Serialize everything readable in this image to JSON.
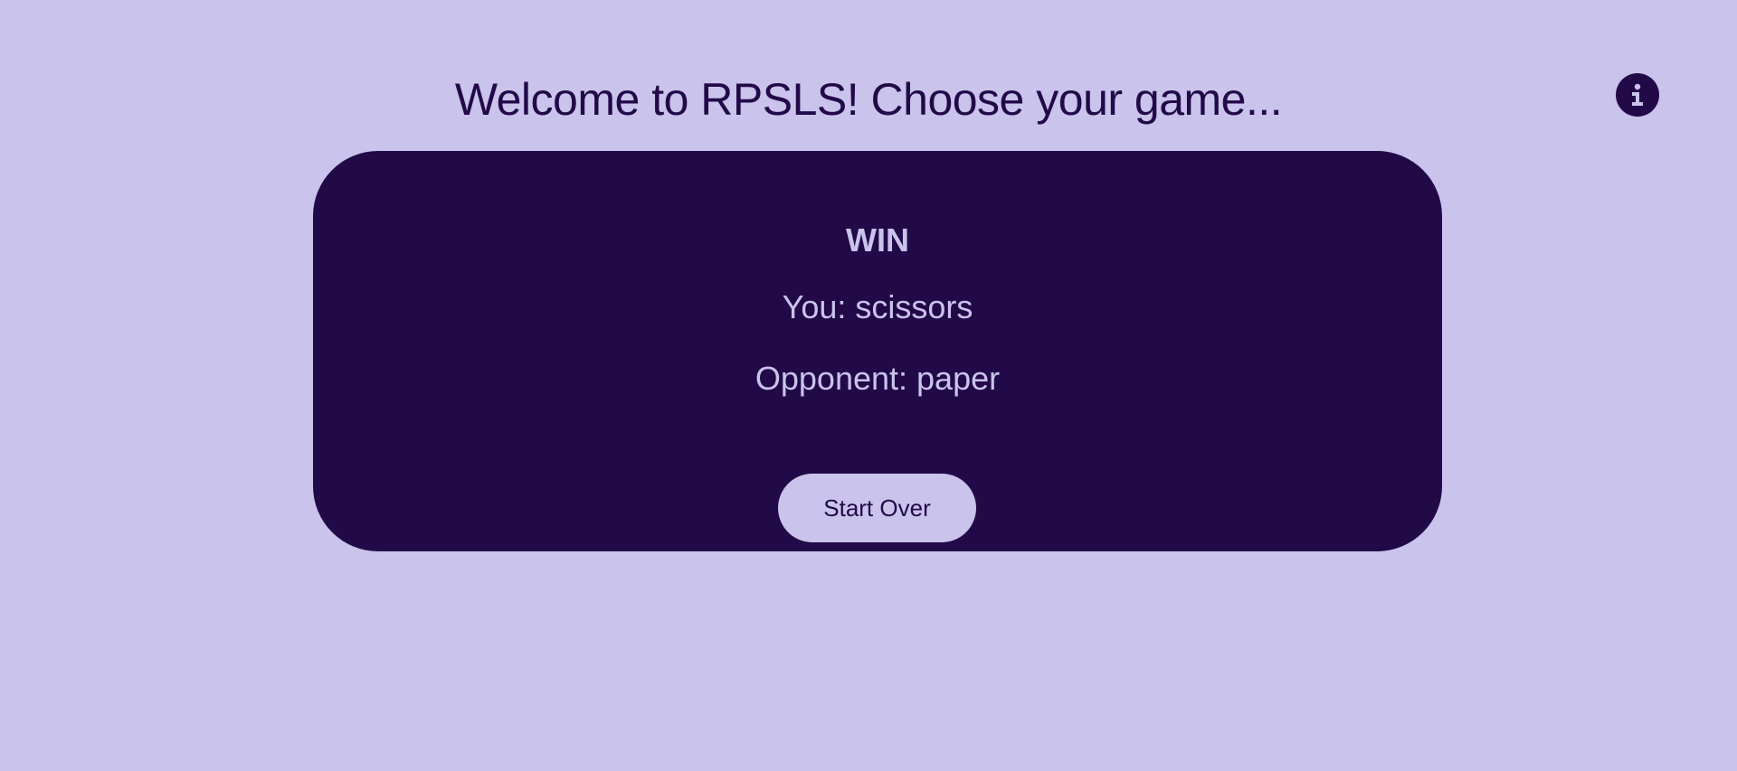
{
  "header": {
    "title": "Welcome to RPSLS! Choose your game...",
    "info_icon": "info-icon"
  },
  "result_card": {
    "outcome": "WIN",
    "you_line": "You: scissors",
    "opponent_line": "Opponent: paper",
    "start_over_label": "Start Over"
  },
  "colors": {
    "background": "#cac3eb",
    "accent_dark": "#220a49"
  }
}
